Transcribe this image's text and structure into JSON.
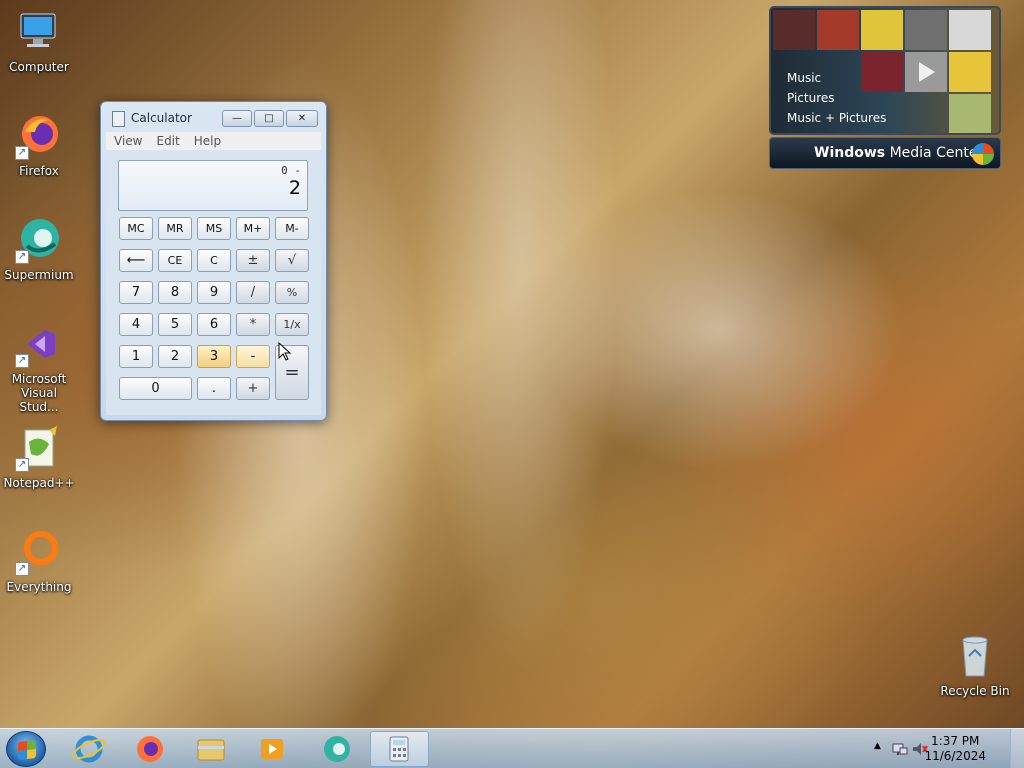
{
  "desktop": {
    "icons": [
      {
        "label": "Computer"
      },
      {
        "label": "Firefox"
      },
      {
        "label": "Supermium"
      },
      {
        "label": "Microsoft Visual Stud..."
      },
      {
        "label": "Notepad++"
      },
      {
        "label": "Everything"
      },
      {
        "label": "Recycle Bin"
      }
    ]
  },
  "calculator": {
    "title": "Calculator",
    "menu": [
      "View",
      "Edit",
      "Help"
    ],
    "window_buttons": {
      "minimize": "—",
      "maximize": "□",
      "close": "✕"
    },
    "display": {
      "expression": "0 -",
      "result": "2"
    },
    "keys": {
      "mc": "MC",
      "mr": "MR",
      "ms": "MS",
      "mplus": "M+",
      "mminus": "M-",
      "back": "⟵",
      "ce": "CE",
      "c": "C",
      "plusminus": "±",
      "sqrt": "√",
      "k7": "7",
      "k8": "8",
      "k9": "9",
      "div": "/",
      "pct": "%",
      "k4": "4",
      "k5": "5",
      "k6": "6",
      "mul": "*",
      "recip": "1/x",
      "k1": "1",
      "k2": "2",
      "k3": "3",
      "sub": "-",
      "eq": "=",
      "k0": "0",
      "dot": ".",
      "add": "+"
    }
  },
  "media_center": {
    "menu": [
      "Music",
      "Pictures",
      "Music + Pictures"
    ],
    "brand_bold": "Windows",
    "brand_rest": " Media Center"
  },
  "taskbar": {
    "clock_time": "1:37 PM",
    "clock_date": "11/6/2024",
    "tray_up": "▲"
  },
  "colors": {
    "accent": "#2f8fd6",
    "hot_key": "#f2cf7c"
  }
}
